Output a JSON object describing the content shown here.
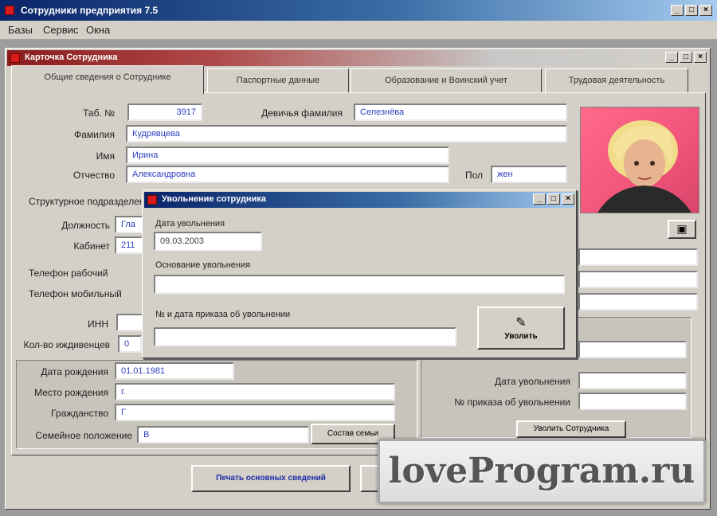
{
  "app": {
    "title": "Сотрудники предприятия 7.5",
    "menu": [
      "Базы",
      "Сервис",
      "Окна"
    ]
  },
  "child_window": {
    "title": "Карточка Сотрудника"
  },
  "tabs": [
    {
      "label": "Общие сведения о Сотруднике"
    },
    {
      "label": "Паспортные данные"
    },
    {
      "label": "Образование и Воинский учет"
    },
    {
      "label": "Трудовая деятельность"
    }
  ],
  "form": {
    "tab_number": {
      "label": "Таб. №",
      "value": "3917"
    },
    "maiden_name": {
      "label": "Девичья фамилия",
      "value": "Селезнёва"
    },
    "surname": {
      "label": "Фамилия",
      "value": "Кудрявцева"
    },
    "name": {
      "label": "Имя",
      "value": "Ирина"
    },
    "patronymic": {
      "label": "Отчество",
      "value": "Александровна"
    },
    "sex": {
      "label": "Пол",
      "value": "жен"
    },
    "division": {
      "label": "Структурное подразделение"
    },
    "position": {
      "label": "Должность",
      "value": "Гла"
    },
    "office": {
      "label": "Кабинет",
      "value": "211"
    },
    "phone_work": {
      "label": "Телефон рабочий"
    },
    "phone_mobile": {
      "label": "Телефон мобильный"
    },
    "inn": {
      "label": "ИНН"
    },
    "dependents": {
      "label": "Кол-во иждивенцев",
      "value": "0"
    },
    "birth_date": {
      "label": "Дата рождения",
      "value": "01.01.1981"
    },
    "birth_place": {
      "label": "Место рождения",
      "value": "г."
    },
    "citizenship": {
      "label": "Гражданство",
      "value": "Г"
    },
    "marital": {
      "label": "Семейное положение",
      "value": "В"
    },
    "family_button": "Состав семьи",
    "dismissal_date": {
      "label": "Дата увольнения"
    },
    "dismissal_order": {
      "label": "№ приказа об увольнении"
    },
    "dismiss_button": "Уволить Сотрудника",
    "print_button": "Печать основных сведений"
  },
  "dialog": {
    "title": "Увольнение сотрудника",
    "date_label": "Дата увольнения",
    "date_value": "09.03.2003",
    "reason_label": "Основание увольнения",
    "order_label": "№ и дата приказа об увольнении",
    "ok_button": "Уволить"
  },
  "watermark": {
    "text": "loveProgram.ru"
  }
}
